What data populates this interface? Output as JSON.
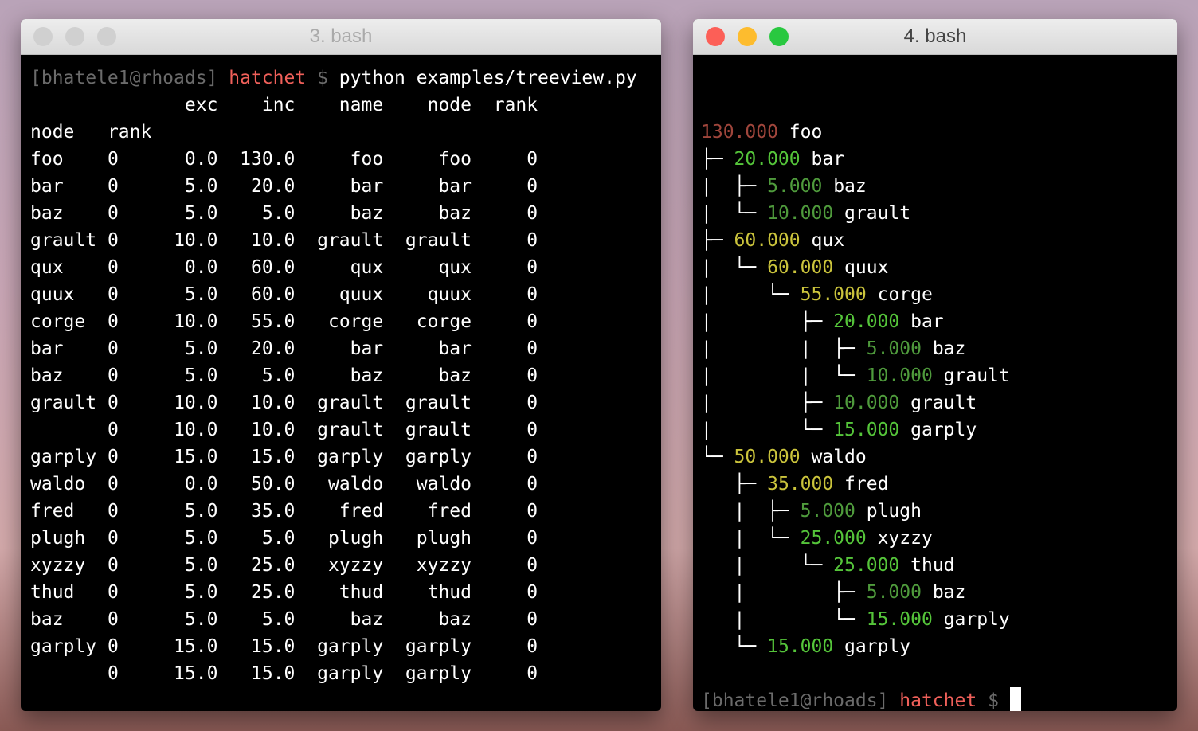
{
  "colors": {
    "red": "#a0463c",
    "green": "#55c53a",
    "dgreen": "#4f9b3c",
    "yellow": "#cbc43c"
  },
  "left": {
    "title": "3. bash",
    "prompt": {
      "user": "[bhatele1@rhoads]",
      "dir": "hatchet",
      "sym": "$",
      "cmd": "python examples/treeview.py"
    },
    "header": [
      "",
      "",
      "exc",
      "inc",
      "name",
      "node",
      "rank"
    ],
    "index_header": [
      "node",
      "rank"
    ],
    "rows": [
      [
        "foo",
        "0",
        "0.0",
        "130.0",
        "foo",
        "foo",
        "0"
      ],
      [
        "bar",
        "0",
        "5.0",
        "20.0",
        "bar",
        "bar",
        "0"
      ],
      [
        "baz",
        "0",
        "5.0",
        "5.0",
        "baz",
        "baz",
        "0"
      ],
      [
        "grault",
        "0",
        "10.0",
        "10.0",
        "grault",
        "grault",
        "0"
      ],
      [
        "qux",
        "0",
        "0.0",
        "60.0",
        "qux",
        "qux",
        "0"
      ],
      [
        "quux",
        "0",
        "5.0",
        "60.0",
        "quux",
        "quux",
        "0"
      ],
      [
        "corge",
        "0",
        "10.0",
        "55.0",
        "corge",
        "corge",
        "0"
      ],
      [
        "bar",
        "0",
        "5.0",
        "20.0",
        "bar",
        "bar",
        "0"
      ],
      [
        "baz",
        "0",
        "5.0",
        "5.0",
        "baz",
        "baz",
        "0"
      ],
      [
        "grault",
        "0",
        "10.0",
        "10.0",
        "grault",
        "grault",
        "0"
      ],
      [
        "",
        "0",
        "10.0",
        "10.0",
        "grault",
        "grault",
        "0"
      ],
      [
        "garply",
        "0",
        "15.0",
        "15.0",
        "garply",
        "garply",
        "0"
      ],
      [
        "waldo",
        "0",
        "0.0",
        "50.0",
        "waldo",
        "waldo",
        "0"
      ],
      [
        "fred",
        "0",
        "5.0",
        "35.0",
        "fred",
        "fred",
        "0"
      ],
      [
        "plugh",
        "0",
        "5.0",
        "5.0",
        "plugh",
        "plugh",
        "0"
      ],
      [
        "xyzzy",
        "0",
        "5.0",
        "25.0",
        "xyzzy",
        "xyzzy",
        "0"
      ],
      [
        "thud",
        "0",
        "5.0",
        "25.0",
        "thud",
        "thud",
        "0"
      ],
      [
        "baz",
        "0",
        "5.0",
        "5.0",
        "baz",
        "baz",
        "0"
      ],
      [
        "garply",
        "0",
        "15.0",
        "15.0",
        "garply",
        "garply",
        "0"
      ],
      [
        "",
        "0",
        "15.0",
        "15.0",
        "garply",
        "garply",
        "0"
      ]
    ]
  },
  "right": {
    "title": "4. bash",
    "prompt": {
      "user": "[bhatele1@rhoads]",
      "dir": "hatchet",
      "sym": "$"
    },
    "tree": [
      {
        "p": "",
        "v": "130.000",
        "n": "foo",
        "c": "red"
      },
      {
        "p": "├─ ",
        "v": "20.000",
        "n": "bar",
        "c": "green"
      },
      {
        "p": "|  ├─ ",
        "v": "5.000",
        "n": "baz",
        "c": "dgreen"
      },
      {
        "p": "|  └─ ",
        "v": "10.000",
        "n": "grault",
        "c": "dgreen"
      },
      {
        "p": "├─ ",
        "v": "60.000",
        "n": "qux",
        "c": "yellow"
      },
      {
        "p": "|  └─ ",
        "v": "60.000",
        "n": "quux",
        "c": "yellow"
      },
      {
        "p": "|     └─ ",
        "v": "55.000",
        "n": "corge",
        "c": "yellow"
      },
      {
        "p": "|        ├─ ",
        "v": "20.000",
        "n": "bar",
        "c": "green"
      },
      {
        "p": "|        |  ├─ ",
        "v": "5.000",
        "n": "baz",
        "c": "dgreen"
      },
      {
        "p": "|        |  └─ ",
        "v": "10.000",
        "n": "grault",
        "c": "dgreen"
      },
      {
        "p": "|        ├─ ",
        "v": "10.000",
        "n": "grault",
        "c": "dgreen"
      },
      {
        "p": "|        └─ ",
        "v": "15.000",
        "n": "garply",
        "c": "green"
      },
      {
        "p": "└─ ",
        "v": "50.000",
        "n": "waldo",
        "c": "yellow"
      },
      {
        "p": "   ├─ ",
        "v": "35.000",
        "n": "fred",
        "c": "yellow"
      },
      {
        "p": "   |  ├─ ",
        "v": "5.000",
        "n": "plugh",
        "c": "dgreen"
      },
      {
        "p": "   |  └─ ",
        "v": "25.000",
        "n": "xyzzy",
        "c": "green"
      },
      {
        "p": "   |     └─ ",
        "v": "25.000",
        "n": "thud",
        "c": "green"
      },
      {
        "p": "   |        ├─ ",
        "v": "5.000",
        "n": "baz",
        "c": "dgreen"
      },
      {
        "p": "   |        └─ ",
        "v": "15.000",
        "n": "garply",
        "c": "green"
      },
      {
        "p": "   └─ ",
        "v": "15.000",
        "n": "garply",
        "c": "green"
      }
    ]
  }
}
